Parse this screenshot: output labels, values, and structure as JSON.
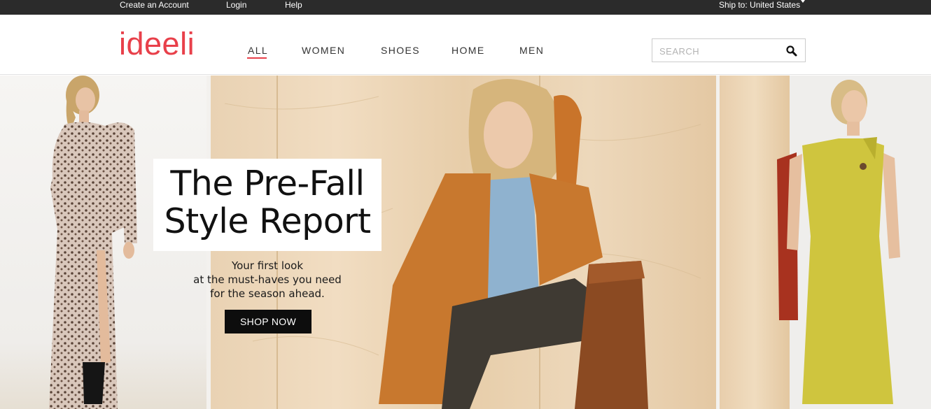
{
  "topbar": {
    "create_account": "Create an Account",
    "login": "Login",
    "help": "Help",
    "ship_to": "Ship to: United States"
  },
  "header": {
    "logo": "ideeli",
    "nav": {
      "all": "ALL",
      "women": "WOMEN",
      "shoes": "SHOES",
      "home": "HOME",
      "men": "MEN"
    },
    "active_nav": "ALL",
    "search": {
      "placeholder": "SEARCH",
      "value": ""
    }
  },
  "hero": {
    "headline": "The Pre-Fall Style Report",
    "headline_line1": "The Pre-Fall",
    "headline_line2": "Style Report",
    "sub_line1": "Your first look",
    "sub_line2": "at the must-haves you need",
    "sub_line3": "for the season ahead.",
    "cta": "SHOP NOW"
  },
  "colors": {
    "brand": "#e8404a",
    "topbar_bg": "#2b2b2b",
    "cta_bg": "#0d0d0d"
  }
}
